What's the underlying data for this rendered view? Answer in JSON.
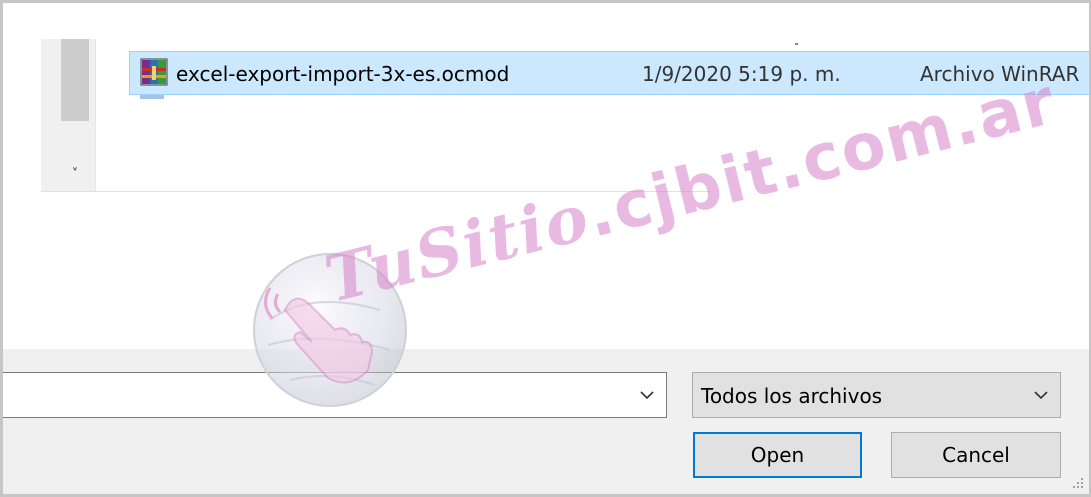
{
  "file_list": {
    "rows": [
      {
        "name": "excel-export-import-3x-es.ocmod",
        "date": "1/9/2020 5:19 p. m.",
        "type": "Archivo WinRAR",
        "icon": "winrar-archive-icon",
        "selected": true
      }
    ],
    "scroll_down_glyph": "˅"
  },
  "footer": {
    "filename_value": "",
    "filetype_selected": "Todos los archivos",
    "open_label": "Open",
    "cancel_label": "Cancel"
  },
  "watermark": {
    "script_part": "TuSitio",
    "domain_part": ".cjbit.com.ar"
  },
  "colors": {
    "selection_bg": "#cce8ff",
    "selection_border": "#99d1ff",
    "focus_border": "#0078d7",
    "watermark": "#d782c8"
  }
}
